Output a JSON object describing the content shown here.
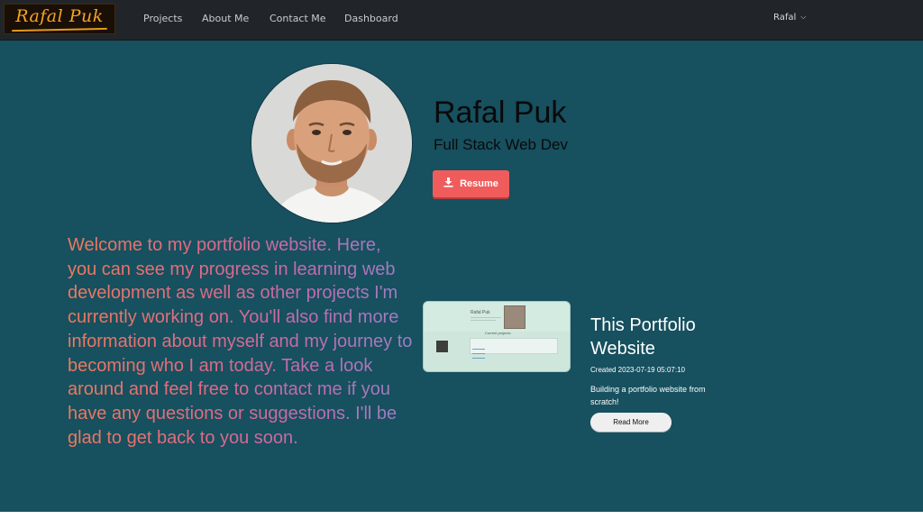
{
  "navbar": {
    "brand": "Rafal Puk",
    "links": [
      "Projects",
      "About Me",
      "Contact Me",
      "Dashboard"
    ],
    "user": "Rafal"
  },
  "hero": {
    "name": "Rafal Puk",
    "role": "Full Stack Web Dev",
    "resume_label": "Resume"
  },
  "welcome": "Welcome to my portfolio website. Here, you can see my progress in learning web development as well as other projects I'm currently working on. You'll also find more information about myself and my journey to becoming who I am today. Take a look around and feel free to contact me if you have any questions or suggestions. I'll be glad to get back to you soon.",
  "project": {
    "title": "This Portfolio Website",
    "created": "Created 2023-07-19 05:07:10",
    "description": "Building a portfolio website from scratch!",
    "read_more_label": "Read More",
    "thumb_name": "Rafal Puk",
    "thumb_section": "Current projects"
  },
  "colors": {
    "navbar": "#212529",
    "background": "#17505f",
    "resume_button": "#f05c5c",
    "brand_text": "#f5a524"
  },
  "icons": {
    "resume": "download-icon",
    "user_menu": "chevron-down-icon"
  }
}
